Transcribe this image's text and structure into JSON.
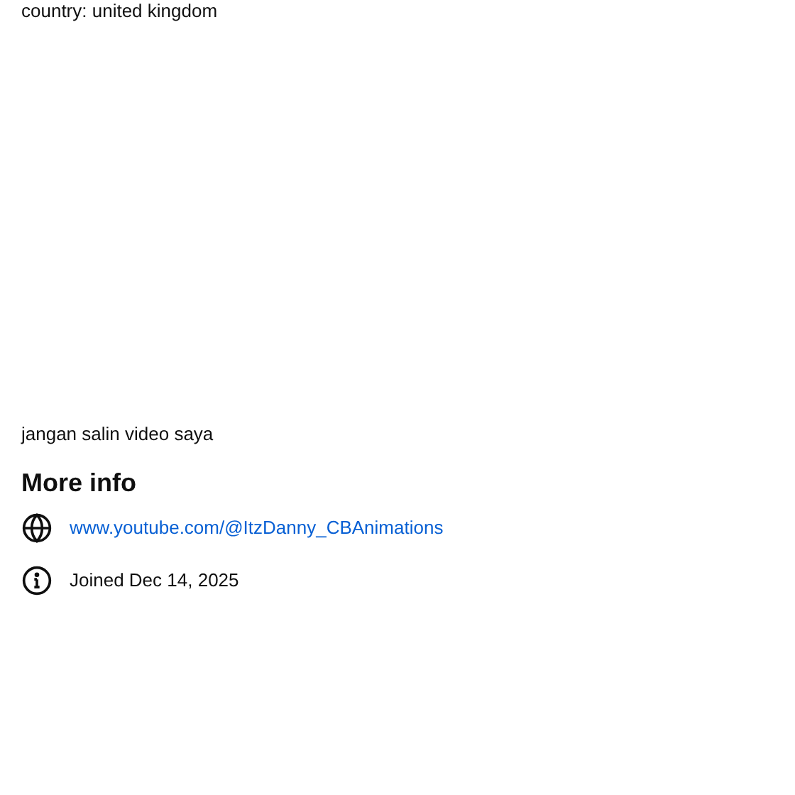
{
  "description": [
    "country: united kingdom",
    "jangan salin video saya"
  ],
  "more_info": {
    "title": "More info",
    "items": [
      {
        "kind": "link",
        "text": "www.youtube.com/@ItzDanny_CBAnimations"
      },
      {
        "kind": "joined",
        "text": "Joined Dec 14, 2025"
      }
    ]
  }
}
